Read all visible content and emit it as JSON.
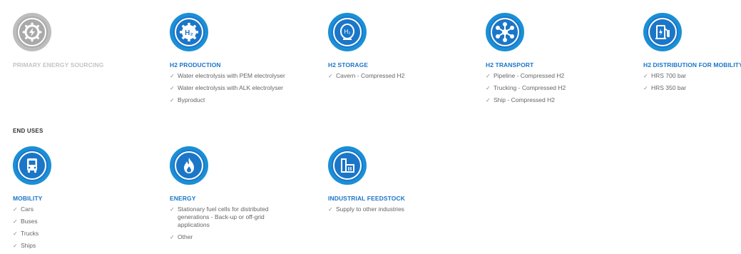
{
  "columns": [
    {
      "title": "PRIMARY ENERGY SOURCING",
      "items": []
    },
    {
      "title": "H2 PRODUCTION",
      "items": [
        "Water electrolysis with PEM electrolyser",
        "Water electrolysis with ALK electrolyser",
        "Byproduct"
      ]
    },
    {
      "title": "H2 STORAGE",
      "items": [
        "Cavern - Compressed H2"
      ]
    },
    {
      "title": "H2 TRANSPORT",
      "items": [
        "Pipeline - Compressed H2",
        "Trucking - Compressed H2",
        "Ship - Compressed H2"
      ]
    },
    {
      "title": "H2 DISTRIBUTION FOR MOBILITY",
      "items": [
        "HRS 700 bar",
        "HRS 350 bar"
      ]
    }
  ],
  "end_uses": {
    "label": "END USES",
    "columns": [
      {
        "title": "MOBILITY",
        "items": [
          "Cars",
          "Buses",
          "Trucks",
          "Ships"
        ]
      },
      {
        "title": "ENERGY",
        "items": [
          "Stationary fuel cells for distributed generations - Back-up or off-grid applications",
          "Other"
        ]
      },
      {
        "title": "INDUSTRIAL FEEDSTOCK",
        "items": [
          "Supply to other industries"
        ]
      }
    ]
  },
  "icons": {
    "col0": "gear-lightning-icon",
    "col1": "h2-gear-icon",
    "col2": "h2-tank-icon",
    "col3": "network-hub-icon",
    "col4": "fuel-pump-icon",
    "eu0": "bus-icon",
    "eu1": "flame-icon",
    "eu2": "factory-icon"
  },
  "colors": {
    "accent": "#1b76c8",
    "ring": "#1a8fd6",
    "inactive": "#a9a9a9"
  }
}
